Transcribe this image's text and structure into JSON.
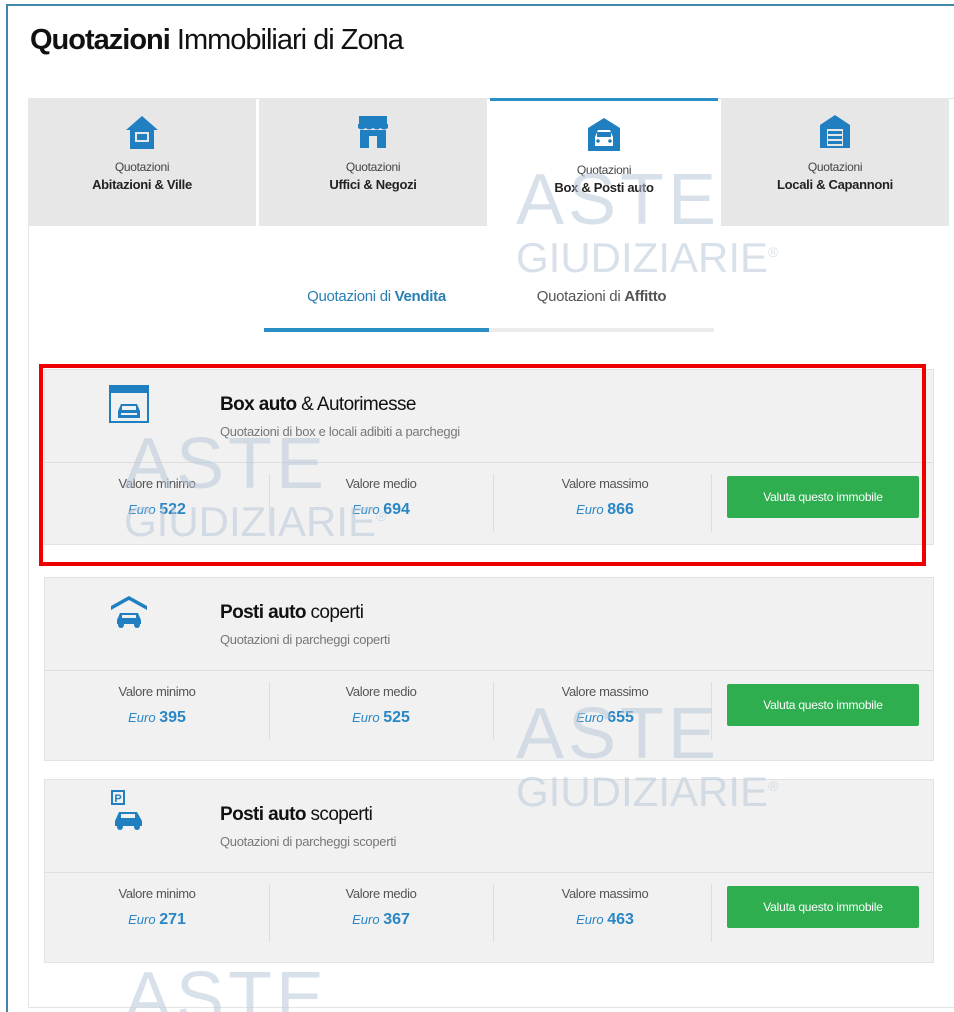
{
  "header": {
    "title_bold": "Quotazioni",
    "title_light": "Immobiliari di Zona"
  },
  "tabs": [
    {
      "line1": "Quotazioni",
      "line2": "Abitazioni & Ville",
      "icon": "house-icon",
      "active": false
    },
    {
      "line1": "Quotazioni",
      "line2": "Uffici & Negozi",
      "icon": "shop-icon",
      "active": false
    },
    {
      "line1": "Quotazioni",
      "line2": "Box & Posti auto",
      "icon": "garage-car-icon",
      "active": true
    },
    {
      "line1": "Quotazioni",
      "line2": "Locali & Capannoni",
      "icon": "warehouse-icon",
      "active": false
    }
  ],
  "subtabs": [
    {
      "prefix": "Quotazioni di",
      "bold": "Vendita",
      "active": true
    },
    {
      "prefix": "Quotazioni di",
      "bold": "Affitto",
      "active": false
    }
  ],
  "cards": [
    {
      "icon": "box-garage-icon",
      "title_bold": "Box auto",
      "title_light": "& Autorimesse",
      "subtitle": "Quotazioni di box e locali adibiti a parcheggi",
      "min_label": "Valore minimo",
      "min_currency": "Euro",
      "min_value": "522",
      "avg_label": "Valore medio",
      "avg_currency": "Euro",
      "avg_value": "694",
      "max_label": "Valore massimo",
      "max_currency": "Euro",
      "max_value": "866",
      "button": "Valuta questo immobile"
    },
    {
      "icon": "covered-parking-icon",
      "title_bold": "Posti auto",
      "title_light": "coperti",
      "subtitle": "Quotazioni di parcheggi coperti",
      "min_label": "Valore minimo",
      "min_currency": "Euro",
      "min_value": "395",
      "avg_label": "Valore medio",
      "avg_currency": "Euro",
      "avg_value": "525",
      "max_label": "Valore massimo",
      "max_currency": "Euro",
      "max_value": "655",
      "button": "Valuta questo immobile"
    },
    {
      "icon": "open-parking-icon",
      "title_bold": "Posti auto",
      "title_light": "scoperti",
      "subtitle": "Quotazioni di parcheggi scoperti",
      "min_label": "Valore minimo",
      "min_currency": "Euro",
      "min_value": "271",
      "avg_label": "Valore medio",
      "avg_currency": "Euro",
      "avg_value": "367",
      "max_label": "Valore massimo",
      "max_currency": "Euro",
      "max_value": "463",
      "button": "Valuta questo immobile"
    }
  ],
  "watermark": {
    "line1": "ASTE",
    "line2": "GIUDIZIARIE",
    "mark": "®"
  },
  "colors": {
    "accent": "#2a8fc4",
    "button": "#2fae4f",
    "value": "#2a86c4",
    "highlight": "#ee0000",
    "icon": "#1f7fc0"
  }
}
